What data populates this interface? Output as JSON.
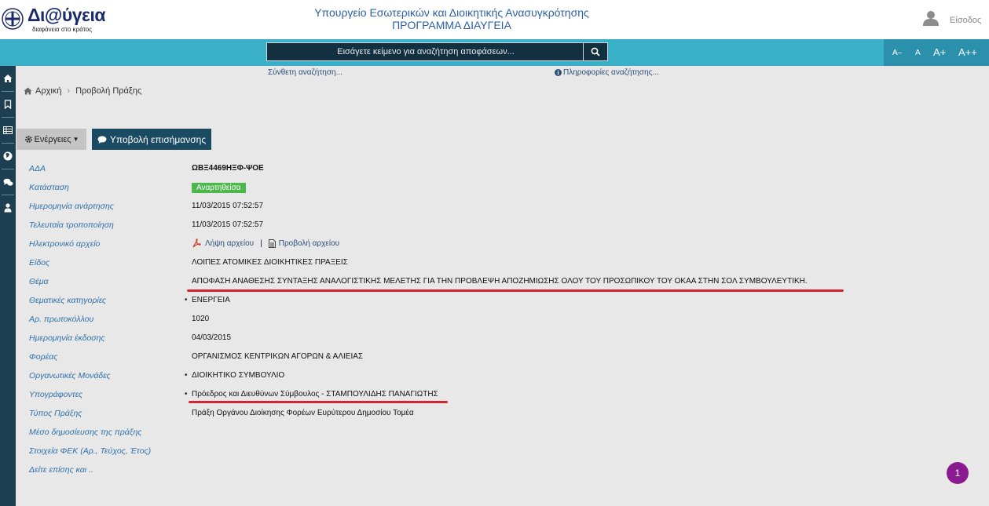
{
  "header": {
    "logo_text": "Δι@ύγεια",
    "logo_tagline": "διαφάνεια στο κράτος",
    "ministry_line1": "Υπουργείο Εσωτερικών και Διοικητικής Ανασυγκρότησης",
    "ministry_line2": "ΠΡΟΓΡΑΜΜΑ ΔΙΑΥΓΕΙΑ",
    "login_label": "Είσοδος"
  },
  "search": {
    "placeholder": "Εισάγετε κείμενο για αναζήτηση αποφάσεων..."
  },
  "font_sizes": [
    "A–",
    "A",
    "A+",
    "A++"
  ],
  "sublinks": {
    "advanced": "Σύνθετη αναζήτηση...",
    "info": "Πληροφορίες αναζήτησης..."
  },
  "sidebar_icons": [
    "home-icon",
    "bookmark-icon",
    "table-icon",
    "globe-icon",
    "comments-icon",
    "user-icon"
  ],
  "breadcrumb": {
    "home": "Αρχική",
    "current": "Προβολή Πράξης"
  },
  "actions": {
    "actions_label": "Ενέργειες",
    "report_label": "Υποβολή επισήμανσης"
  },
  "fields": {
    "ada": {
      "label": "ΑΔΑ",
      "value": "ΩΒΞ4469ΗΞΦ-ΨΟΕ"
    },
    "status": {
      "label": "Κατάσταση",
      "value": "Αναρτηθείσα"
    },
    "published": {
      "label": "Ημερομηνία ανάρτησης",
      "value": "11/03/2015 07:52:57"
    },
    "modified": {
      "label": "Τελευταία τροποποίηση",
      "value": "11/03/2015 07:52:57"
    },
    "file": {
      "label": "Ηλεκτρονικό αρχείο",
      "download": "Λήψη αρχείου",
      "view": "Προβολή αρχείου"
    },
    "type": {
      "label": "Είδος",
      "value": "ΛΟΙΠΕΣ ΑΤΟΜΙΚΕΣ ΔΙΟΙΚΗΤΙΚΕΣ ΠΡΑΞΕΙΣ"
    },
    "subject": {
      "label": "Θέμα",
      "value": "ΑΠΟΦΑΣΗ ΑΝΑΘΕΣΗΣ ΣΥΝΤΑΞΗΣ ΑΝΑΛΟΓΙΣΤΙΚΗΣ ΜΕΛΕΤΗΣ ΓΙΑ ΤΗΝ ΠΡΟΒΛΕΨΗ ΑΠΟΖΗΜΙΩΣΗΣ ΟΛΟΥ ΤΟΥ ΠΡΟΣΩΠΙΚΟΥ ΤΟΥ ΟΚΑΑ ΣΤΗΝ ΣΟΛ ΣΥΜΒΟΥΛΕΥΤΙΚΗ."
    },
    "categories": {
      "label": "Θεματικές κατηγορίες",
      "value": "ΕΝΕΡΓΕΙΑ"
    },
    "protocol": {
      "label": "Αρ. πρωτοκόλλου",
      "value": "1020"
    },
    "issue_date": {
      "label": "Ημερομηνία έκδοσης",
      "value": "04/03/2015"
    },
    "organization": {
      "label": "Φορέας",
      "value": "ΟΡΓΑΝΙΣΜΟΣ ΚΕΝΤΡΙΚΩΝ ΑΓΟΡΩΝ & ΑΛΙΕΙΑΣ"
    },
    "units": {
      "label": "Οργανωτικές Μονάδες",
      "value": "ΔΙΟΙΚΗΤΙΚΟ ΣΥΜΒΟΥΛΙΟ"
    },
    "signers": {
      "label": "Υπογράφοντες",
      "value": "Πρόεδρος και Διευθύνων Σύμβουλος - ΣΤΑΜΠΟΥΛΙΔΗΣ ΠΑΝΑΓΙΩΤΗΣ"
    },
    "act_type": {
      "label": "Τύπος Πράξης",
      "value": "Πράξη Οργάνου Διοίκησης Φορέων Ευρύτερου Δημοσίου Τομέα"
    },
    "publication_medium": {
      "label": "Μέσο δημοσίευσης της πράξης"
    },
    "fek": {
      "label": "Στοιχεία ΦΕΚ (Αρ., Τεύχος, Έτος)"
    },
    "see_also": {
      "label": "Δείτε επίσης και .."
    }
  },
  "notification_count": "1",
  "colors": {
    "topbar": "#3ab0c8",
    "sidebar": "#1e3f52",
    "label_blue": "#2e6fa8",
    "status_green": "#4cb84c",
    "underline_red": "#d4242f",
    "notification_purple": "#8a1a8f"
  }
}
